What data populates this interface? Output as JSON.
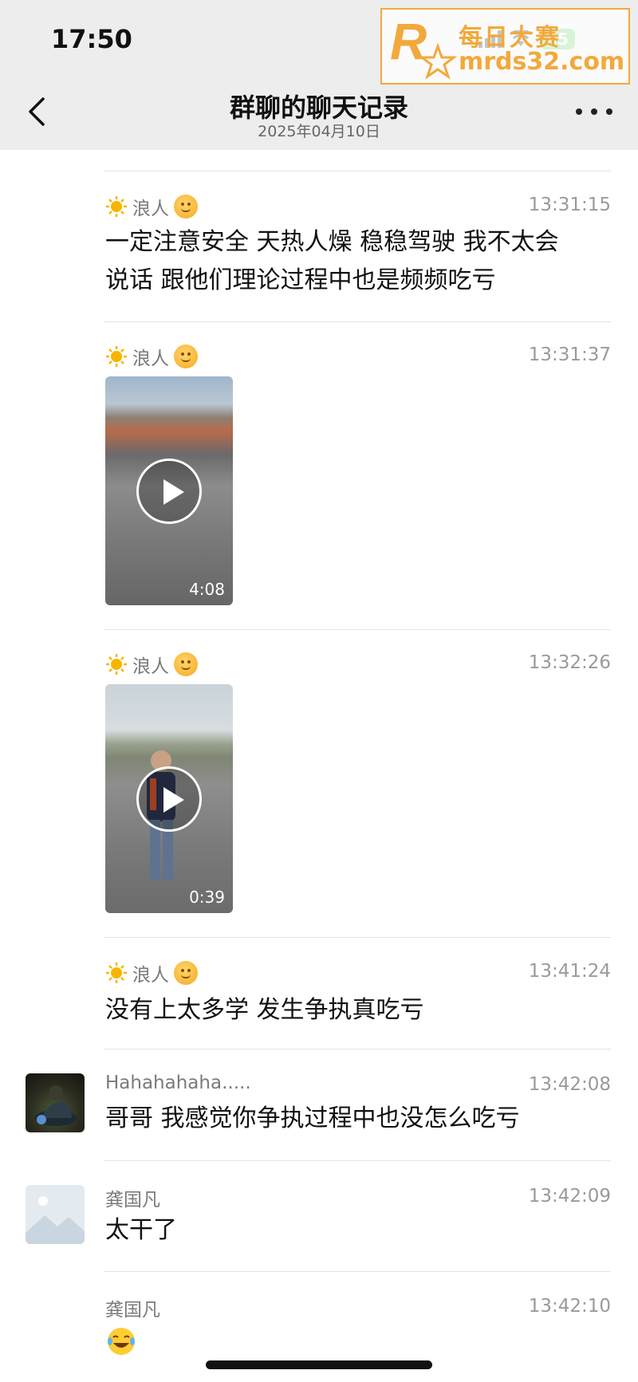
{
  "status_bar": {
    "time": "17:50",
    "battery": "85"
  },
  "header": {
    "title": "群聊的聊天记录",
    "subtitle": "2025年04月10日"
  },
  "watermark": {
    "line1": "每日大赛",
    "line2": "mrds32.com",
    "logo_text": "每日大赛"
  },
  "messages": [
    {
      "sender": "浪人",
      "time": "13:31:15",
      "type": "text",
      "lines": [
        "一定注意安全 天热人燥 稳稳驾驶 我不太会",
        "说话 跟他们理论过程中也是频频吃亏"
      ]
    },
    {
      "sender": "浪人",
      "time": "13:31:37",
      "type": "video",
      "duration": "4:08"
    },
    {
      "sender": "浪人",
      "time": "13:32:26",
      "type": "video",
      "duration": "0:39"
    },
    {
      "sender": "浪人",
      "time": "13:41:24",
      "type": "text",
      "lines": [
        "没有上太多学 发生争执真吃亏"
      ]
    },
    {
      "sender": "Hahahahaha.....",
      "time": "13:42:08",
      "type": "text",
      "lines": [
        "哥哥 我感觉你争执过程中也没怎么吃亏"
      ]
    },
    {
      "sender": "龚国凡",
      "time": "13:42:09",
      "type": "text",
      "lines": [
        "太干了"
      ]
    },
    {
      "sender": "龚国凡",
      "time": "13:42:10",
      "type": "emoji",
      "emoji": "tears-of-joy"
    }
  ],
  "colors": {
    "header_bg": "#ededed",
    "watermark": "#f2a93b",
    "battery": "#5fd35f"
  }
}
